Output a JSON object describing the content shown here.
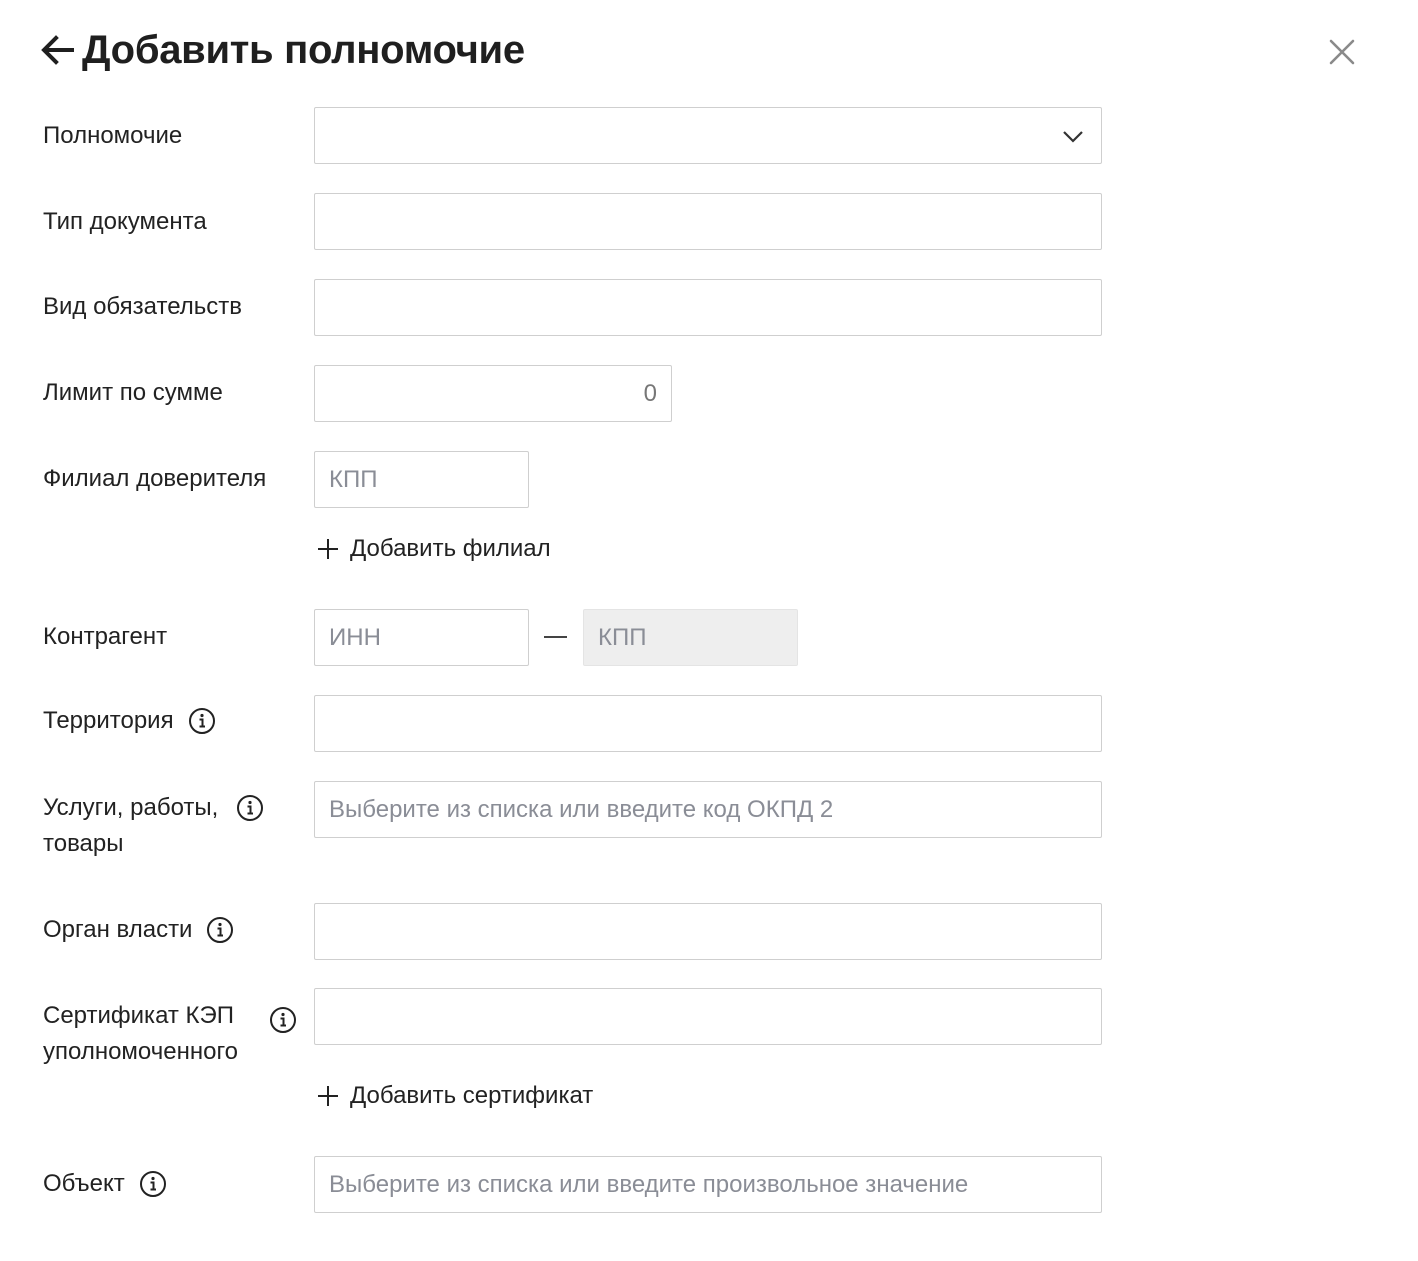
{
  "dialog": {
    "title": "Добавить полномочие"
  },
  "fields": {
    "authority": {
      "label": "Полномочие",
      "value": ""
    },
    "document_type": {
      "label": "Тип документа",
      "value": ""
    },
    "obligation_type": {
      "label": "Вид обязательств",
      "value": ""
    },
    "amount_limit": {
      "label": "Лимит по сумме",
      "placeholder": "0"
    },
    "principal_branch": {
      "label": "Филиал доверителя",
      "placeholder": "КПП"
    },
    "add_branch": {
      "label": "Добавить филиал"
    },
    "counterparty": {
      "label": "Контрагент",
      "inn_placeholder": "ИНН",
      "kpp_placeholder": "КПП"
    },
    "territory": {
      "label": "Территория",
      "value": ""
    },
    "services": {
      "label_line1": "Услуги, работы,",
      "label_line2": "товары",
      "placeholder": "Выберите из списка или введите код ОКПД 2"
    },
    "authority_body": {
      "label": "Орган власти",
      "value": ""
    },
    "certificate": {
      "label_line1": "Сертификат КЭП",
      "label_line2": "уполномоченного",
      "value": ""
    },
    "add_certificate": {
      "label": "Добавить сертификат"
    },
    "object": {
      "label": "Объект",
      "placeholder": "Выберите из списка или введите произвольное значение"
    }
  },
  "icons": {
    "back": "arrow-left-icon",
    "close": "close-icon",
    "chevron": "chevron-down-icon",
    "info": "info-icon",
    "plus": "plus-icon"
  },
  "colors": {
    "border": "#cfcfcf",
    "placeholder": "#8a8d96",
    "disabled_bg": "#eeeeee",
    "text": "#222222"
  }
}
